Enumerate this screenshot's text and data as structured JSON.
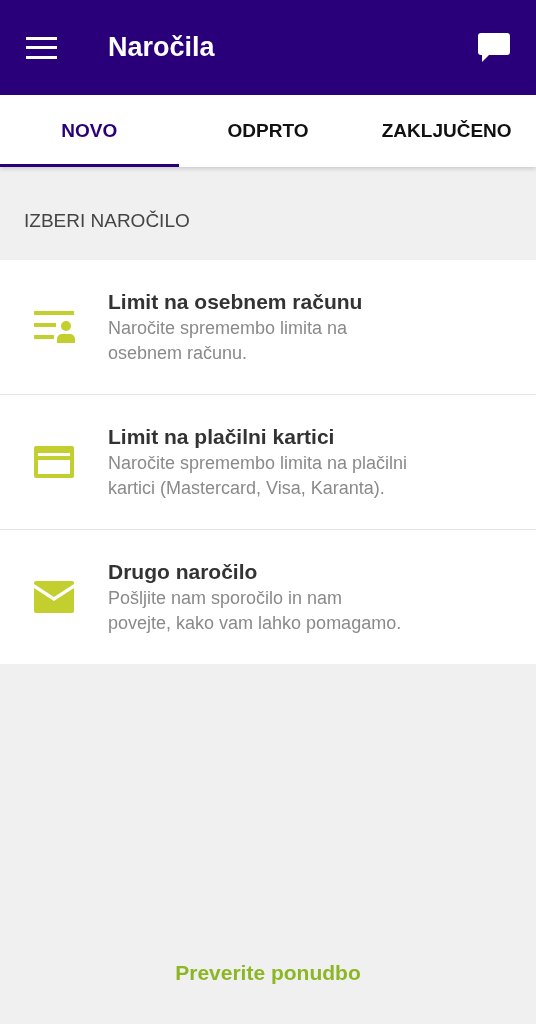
{
  "app_bar": {
    "title": "Naročila"
  },
  "tabs": [
    {
      "label": "NOVO",
      "selected": true
    },
    {
      "label": "ODPRTO",
      "selected": false
    },
    {
      "label": "ZAKLJUČENO",
      "selected": false
    }
  ],
  "section_title": "IZBERI NAROČILO",
  "items": [
    {
      "kind": "account",
      "title": "Limit na osebnem računu",
      "description": "Naročite spremembo limita na osebnem računu."
    },
    {
      "kind": "card",
      "title": "Limit na plačilni kartici",
      "description": "Naročite spremembo limita na plačilni kartici (Mastercard, Visa, Karanta)."
    },
    {
      "kind": "mail",
      "title": "Drugo naročilo",
      "description": "Pošljite nam sporočilo in nam povejte, kako vam lahko pomagamo."
    }
  ],
  "footer_link": "Preverite ponudbo"
}
